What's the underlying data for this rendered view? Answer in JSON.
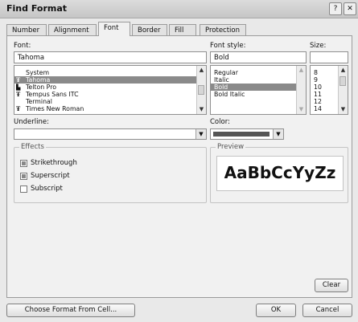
{
  "window": {
    "title": "Find Format",
    "help_glyph": "?",
    "close_glyph": "✕"
  },
  "tabs": [
    {
      "label": "Number"
    },
    {
      "label": "Alignment"
    },
    {
      "label": "Font"
    },
    {
      "label": "Border"
    },
    {
      "label": "Fill"
    },
    {
      "label": "Protection"
    }
  ],
  "font": {
    "label": "Font:",
    "value": "Tahoma",
    "items": [
      {
        "label": "System",
        "truetype": false,
        "selected": false
      },
      {
        "label": "Tahoma",
        "truetype": true,
        "selected": true
      },
      {
        "label": "Telton Pro",
        "truetype": true,
        "selected": false
      },
      {
        "label": "Tempus Sans ITC",
        "truetype": true,
        "selected": false
      },
      {
        "label": "Terminal",
        "truetype": false,
        "selected": false
      },
      {
        "label": "Times New Roman",
        "truetype": true,
        "selected": false
      }
    ]
  },
  "font_style": {
    "label": "Font style:",
    "value": "Bold",
    "items": [
      {
        "label": "Regular",
        "selected": false
      },
      {
        "label": "Italic",
        "selected": false
      },
      {
        "label": "Bold",
        "selected": true
      },
      {
        "label": "Bold Italic",
        "selected": false
      }
    ]
  },
  "size": {
    "label": "Size:",
    "value": "",
    "items": [
      {
        "label": "8"
      },
      {
        "label": "9"
      },
      {
        "label": "10"
      },
      {
        "label": "11"
      },
      {
        "label": "12"
      },
      {
        "label": "14"
      }
    ]
  },
  "underline": {
    "label": "Underline:",
    "value": ""
  },
  "color": {
    "label": "Color:",
    "swatch": "#555555"
  },
  "effects": {
    "title": "Effects",
    "items": [
      {
        "label": "Strikethrough",
        "state": "indeterminate"
      },
      {
        "label": "Superscript",
        "state": "indeterminate"
      },
      {
        "label": "Subscript",
        "state": "unchecked"
      }
    ]
  },
  "preview": {
    "title": "Preview",
    "sample": "AaBbCcYyZz"
  },
  "buttons": {
    "clear": "Clear",
    "choose_format": "Choose Format From Cell...",
    "ok": "OK",
    "cancel": "Cancel"
  }
}
